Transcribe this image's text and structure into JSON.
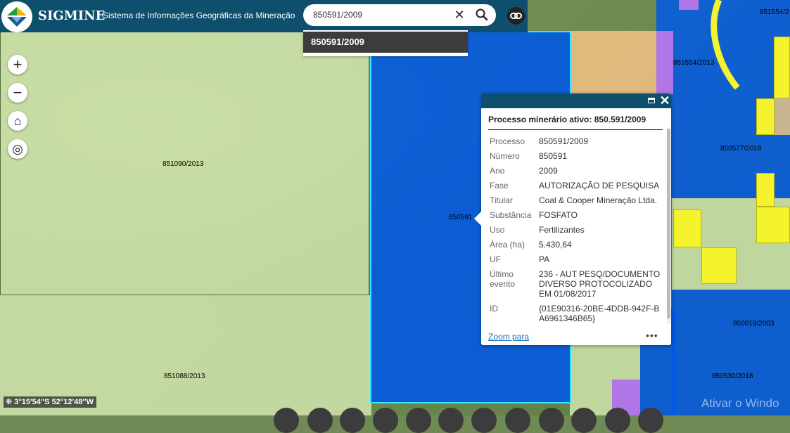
{
  "header": {
    "brand": "SIGMINE",
    "subtitle": "Sistema de Informações Geográficas da Mineração",
    "logo_icon": "sigmine-logo-icon",
    "accent_color": "#0f4f6e"
  },
  "search": {
    "value": "850591/2009",
    "clear_icon": "close-icon",
    "search_icon": "search-icon",
    "link_icon": "link-icon"
  },
  "suggestions": [
    {
      "label": "850591/2009"
    }
  ],
  "map_controls": [
    {
      "name": "zoom-in-button",
      "icon": "plus-icon",
      "glyph": "+"
    },
    {
      "name": "zoom-out-button",
      "icon": "minus-icon",
      "glyph": "−"
    },
    {
      "name": "home-button",
      "icon": "home-icon",
      "glyph": "⌂"
    },
    {
      "name": "locate-button",
      "icon": "locate-icon",
      "glyph": "◎"
    }
  ],
  "parcel_labels": {
    "p851090": "851090/2013",
    "p851088": "851088/2013",
    "p850591": "850591",
    "p851554a": "851554/2013",
    "p851554b": "851554/2",
    "p850577": "850577/2018",
    "p850019": "850019/2003",
    "p850530": "850530/2018"
  },
  "popup": {
    "title": "Processo minerário ativo: 850.591/2009",
    "fields": {
      "processo": {
        "label": "Processo",
        "value": "850591/2009"
      },
      "numero": {
        "label": "Número",
        "value": "850591"
      },
      "ano": {
        "label": "Ano",
        "value": "2009"
      },
      "fase": {
        "label": "Fase",
        "value": "AUTORIZAÇÃO DE PESQUISA"
      },
      "titular": {
        "label": "Titular",
        "value": "Coal & Cooper Mineração Ltda."
      },
      "substancia": {
        "label": "Substância",
        "value": "FOSFATO"
      },
      "uso": {
        "label": "Uso",
        "value": "Fertilizantes"
      },
      "area": {
        "label": "Área (ha)",
        "value": "5.430,64"
      },
      "uf": {
        "label": "UF",
        "value": "PA"
      },
      "ultimo_evento": {
        "label": "Último evento",
        "value": "236 - AUT PESQ/DOCUMENTO DIVERSO PROTOCOLIZADO EM 01/08/2017"
      },
      "id": {
        "label": "ID",
        "value": "{01E90316-20BE-4DDB-942F-BA6961346B65}"
      }
    },
    "zoom_link": "Zoom para",
    "more_glyph": "•••",
    "close_glyph": "✕",
    "maximize_icon": "maximize-icon"
  },
  "coordinates": {
    "icon": "crosshair-icon",
    "text": "3°15′54″S 52°12′48″W"
  },
  "watermark": "Ativar o Windo",
  "colors": {
    "selected_parcel": "#0058e6",
    "selected_border": "#32e6ff",
    "green_parcel": "#d6e9b2",
    "yellow_parcel": "#f4f32d",
    "purple_parcel": "#b075e6",
    "orange_parcel": "#ecbe82"
  }
}
